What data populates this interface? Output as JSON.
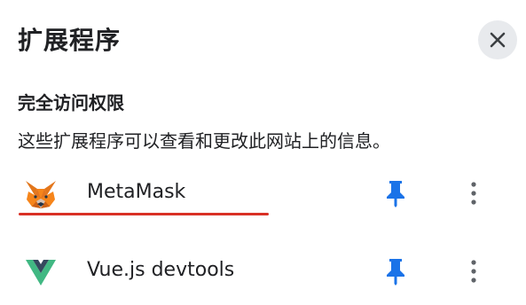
{
  "panel": {
    "title": "扩展程序",
    "close_icon": "close-icon"
  },
  "full_access": {
    "heading": "完全访问权限",
    "description": "这些扩展程序可以查看和更改此网站上的信息。"
  },
  "extensions": [
    {
      "name": "MetaMask",
      "icon": "metamask-fox-icon",
      "pinned": true
    },
    {
      "name": "Vue.js devtools",
      "icon": "vue-logo-icon",
      "pinned": true
    }
  ],
  "colors": {
    "pin": "#1a73e8",
    "underline": "#d93025",
    "close_bg": "#e8eaed",
    "vue_green": "#41b883",
    "vue_dark": "#35495e"
  }
}
